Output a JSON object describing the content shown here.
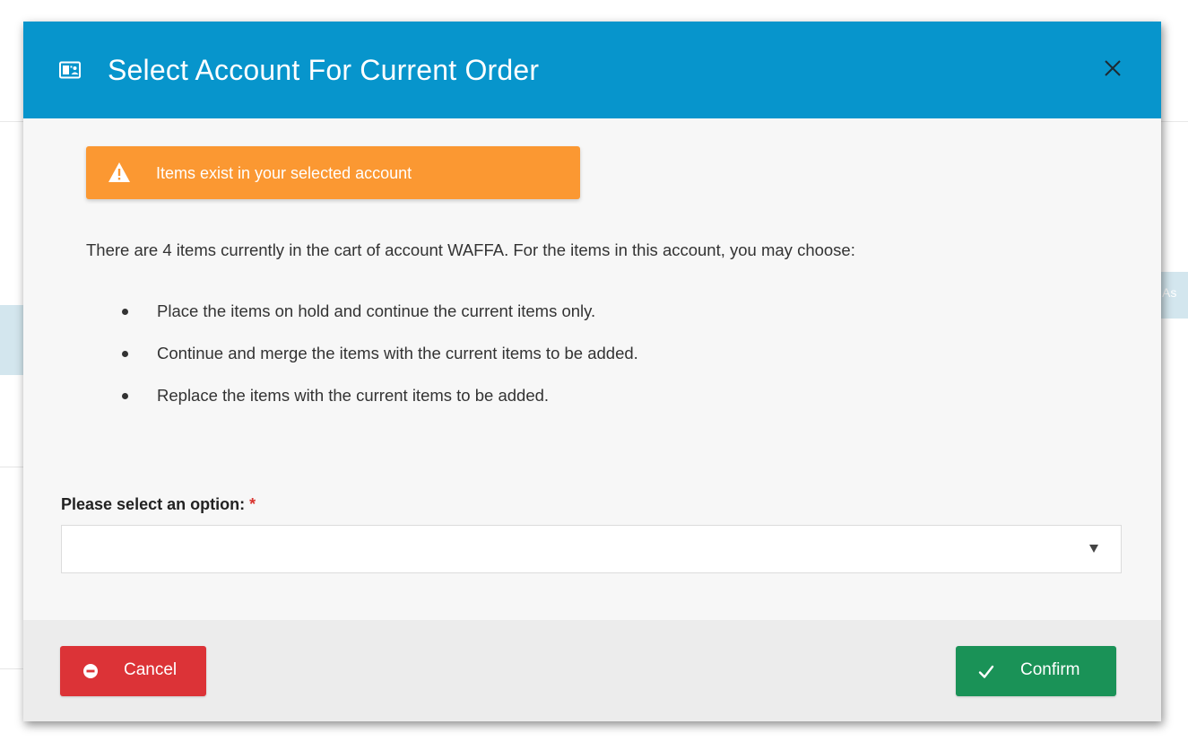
{
  "modal": {
    "title": "Select Account For Current Order",
    "header_icon": "contact-card-icon",
    "close_icon": "close-icon"
  },
  "alert": {
    "icon": "warning-triangle-icon",
    "text": "Items exist in your selected account"
  },
  "body": {
    "intro": "There are 4 items currently in the cart of account WAFFA. For the items in this account, you may choose:",
    "options": [
      "Place the items on hold and continue the current items only.",
      "Continue and merge the items with the current items to be added.",
      "Replace the items with the current items to be added."
    ]
  },
  "form": {
    "label": "Please select an option:",
    "required_marker": "*",
    "selected_value": ""
  },
  "footer": {
    "cancel_label": "Cancel",
    "cancel_icon": "minus-circle-icon",
    "confirm_label": "Confirm",
    "confirm_icon": "checkmark-icon"
  },
  "background": {
    "fragment_text": "As"
  },
  "colors": {
    "header": "#0795cc",
    "alert": "#fb9832",
    "cancel": "#dc3337",
    "confirm": "#1a9257",
    "required": "#d9342f"
  }
}
